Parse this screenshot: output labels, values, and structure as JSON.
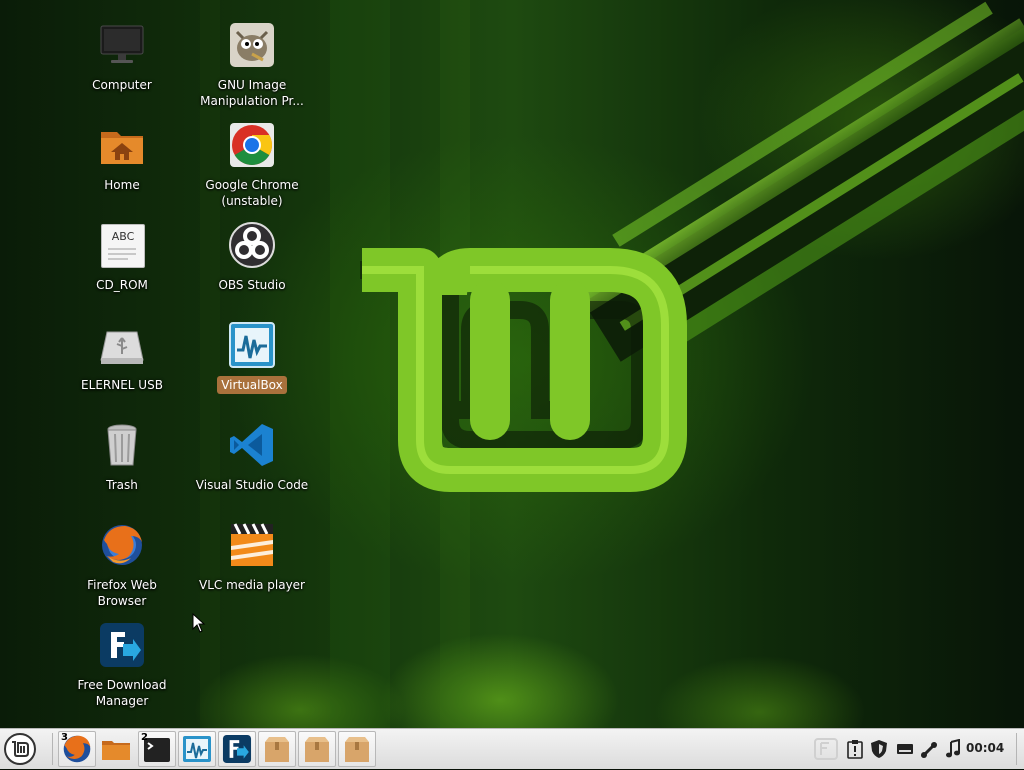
{
  "desktop_icons": {
    "computer": "Computer",
    "home": "Home",
    "cdrom": "CD_ROM",
    "cdrom_glyph": "ABC",
    "usb": "ELERNEL USB",
    "trash": "Trash",
    "firefox": "Firefox Web Browser",
    "fdm": "Free Download Manager",
    "gimp": "GNU Image Manipulation Pr...",
    "chrome": "Google Chrome (unstable)",
    "obs": "OBS Studio",
    "virtualbox": "VirtualBox",
    "vscode": "Visual Studio Code",
    "vlc": "VLC media player"
  },
  "taskbar": {
    "firefox_count": "3",
    "terminal_count": "2"
  },
  "tray": {
    "clock": "00:04"
  },
  "colors": {
    "selection": "#a9713c",
    "panel": "#e6e6e6",
    "mint_green": "#8bd12a"
  }
}
